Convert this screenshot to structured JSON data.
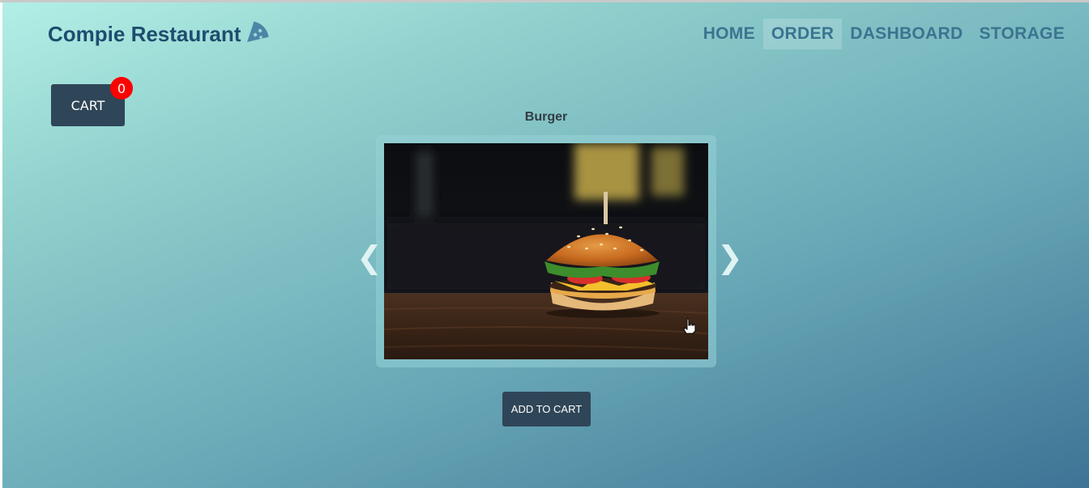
{
  "brand": {
    "name": "Compie Restaurant",
    "icon": "pizza-slice-icon"
  },
  "nav": {
    "items": [
      {
        "label": "HOME",
        "active": false
      },
      {
        "label": "ORDER",
        "active": true
      },
      {
        "label": "DASHBOARD",
        "active": false
      },
      {
        "label": "STORAGE",
        "active": false
      }
    ]
  },
  "cart": {
    "label": "CART",
    "count": "0"
  },
  "product": {
    "name": "Burger",
    "image": "burger-photo",
    "prev_arrow": "❮",
    "next_arrow": "❯"
  },
  "actions": {
    "add_to_cart": "ADD TO CART"
  },
  "colors": {
    "brand_text": "#1e4d6e",
    "nav_text": "#3a7490",
    "button_bg": "#2f4658",
    "badge_bg": "#ff0000"
  }
}
